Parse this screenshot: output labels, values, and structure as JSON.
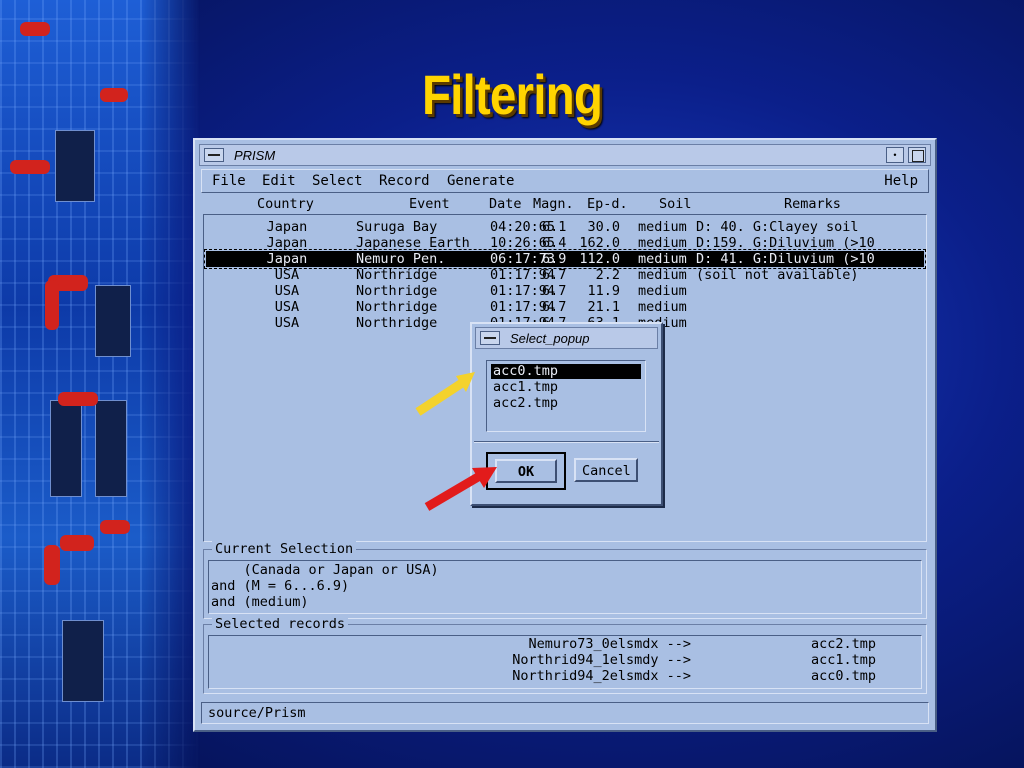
{
  "slide": {
    "title": "Filtering"
  },
  "window": {
    "title": "PRISM",
    "min_glyph": "•",
    "menu": {
      "file": "File",
      "edit": "Edit",
      "select": "Select",
      "record": "Record",
      "generate": "Generate",
      "help": "Help"
    },
    "columns": {
      "country": "Country",
      "event": "Event",
      "date": "Date",
      "magn": "Magn.",
      "epd": "Ep-d.",
      "soil": "Soil",
      "remarks": "Remarks"
    },
    "records": [
      {
        "country": "Japan",
        "event": "Suruga Bay",
        "date": "04:20:65",
        "magn": "6.1",
        "epd": "30.0",
        "soil": "medium",
        "remarks": "D: 40. G:Clayey soil"
      },
      {
        "country": "Japan",
        "event": "Japanese Earth",
        "date": "10:26:65",
        "magn": "6.4",
        "epd": "162.0",
        "soil": "medium",
        "remarks": "D:159. G:Diluvium (>10"
      },
      {
        "country": "Japan",
        "event": "Nemuro Pen.",
        "date": "06:17:73",
        "magn": "6.9",
        "epd": "112.0",
        "soil": "medium",
        "remarks": "D: 41. G:Diluvium (>10"
      },
      {
        "country": "USA",
        "event": "Northridge",
        "date": "01:17:94",
        "magn": "6.7",
        "epd": "2.2",
        "soil": "medium",
        "remarks": "(soil not available)"
      },
      {
        "country": "USA",
        "event": "Northridge",
        "date": "01:17:94",
        "magn": "6.7",
        "epd": "11.9",
        "soil": "medium",
        "remarks": ""
      },
      {
        "country": "USA",
        "event": "Northridge",
        "date": "01:17:94",
        "magn": "6.7",
        "epd": "21.1",
        "soil": "medium",
        "remarks": ""
      },
      {
        "country": "USA",
        "event": "Northridge",
        "date": "01:17:94",
        "magn": "6.7",
        "epd": "63.1",
        "soil": "medium",
        "remarks": ""
      }
    ],
    "current_selection": {
      "label": "Current Selection",
      "lines": [
        "    (Canada or Japan or USA)",
        "and (M = 6...6.9)",
        "and (medium)"
      ]
    },
    "selected_records": {
      "label": "Selected records",
      "items": [
        {
          "name": "Nemuro73_0elsmdx -->",
          "file": "acc2.tmp"
        },
        {
          "name": "Northrid94_1elsmdy -->",
          "file": "acc1.tmp"
        },
        {
          "name": "Northrid94_2elsmdx -->",
          "file": "acc0.tmp"
        }
      ]
    },
    "status": "source/Prism"
  },
  "popup": {
    "title": "Select_popup",
    "items": [
      "acc0.tmp",
      "acc1.tmp",
      "acc2.tmp"
    ],
    "ok": "OK",
    "cancel": "Cancel"
  },
  "colors": {
    "title": "#ffd400",
    "window_bg": "#a9bfe3",
    "arrow_red": "#e21b1b",
    "arrow_yellow": "#f4d22c"
  }
}
